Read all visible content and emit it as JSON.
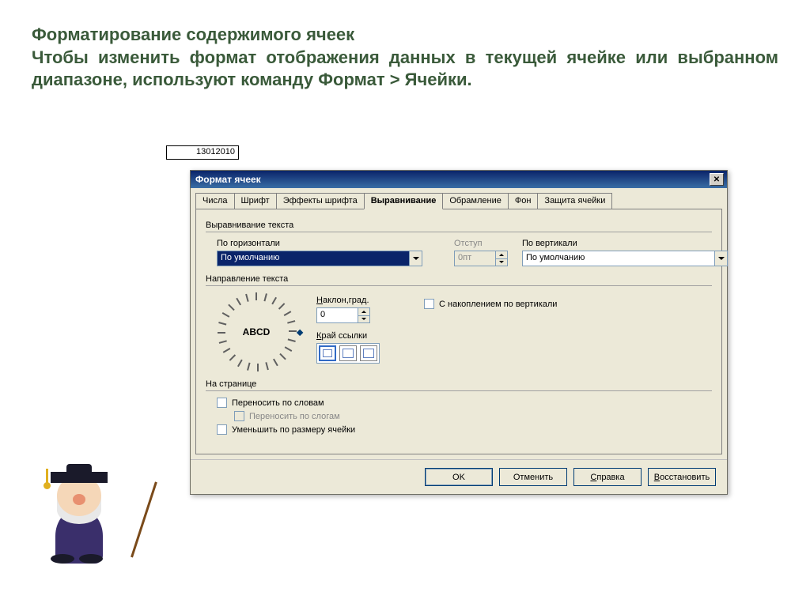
{
  "slide": {
    "title_html": "Форматирование содержимого ячеек<br>Чтобы изменить формат отображения данных в текущей ячейке или выбранном диапазоне, используют команду Формат > Ячейки."
  },
  "cell_value": "13012010",
  "dialog": {
    "title": "Формат ячеек",
    "tabs": [
      "Числа",
      "Шрифт",
      "Эффекты шрифта",
      "Выравнивание",
      "Обрамление",
      "Фон",
      "Защита ячейки"
    ],
    "active_tab": 3,
    "align_group": "Выравнивание текста",
    "horiz_label": "По горизонтали",
    "horiz_value": "По умолчанию",
    "indent_label": "Отступ",
    "indent_value": "0пт",
    "vert_label": "По вертикали",
    "vert_value": "По умолчанию",
    "dir_group": "Направление текста",
    "dial_text": "ABCD",
    "angle_label": "Наклон,град.",
    "angle_value": "0",
    "stack_label": "С накоплением по вертикали",
    "ref_label": "Край ссылки",
    "page_group": "На странице",
    "wrap_label": "Переносить по словам",
    "hyphen_label": "Переносить по слогам",
    "shrink_label": "Уменьшить по размеру ячейки",
    "buttons": {
      "ok": "OK",
      "cancel": "Отменить",
      "help": "Справка",
      "reset": "Восстановить"
    }
  }
}
